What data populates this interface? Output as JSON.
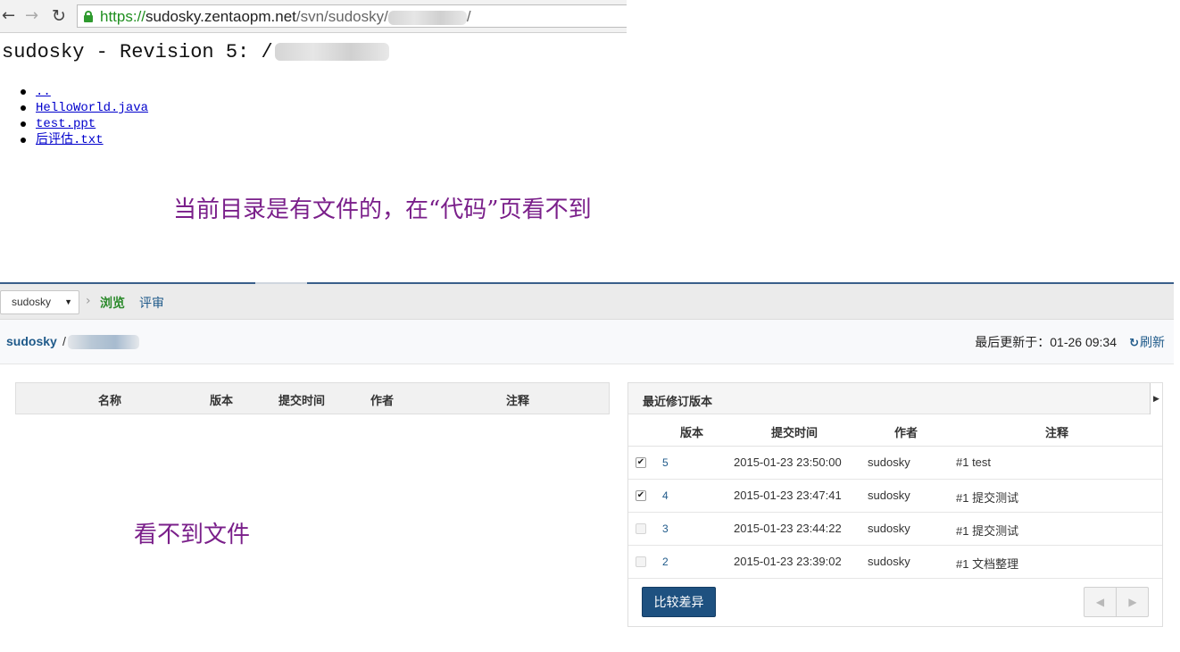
{
  "browser": {
    "url_scheme": "https://",
    "url_host": "sudosky.zentaopm.net",
    "url_path": "/svn/sudosky/",
    "url_tail": "/"
  },
  "svn_listing": {
    "title": "sudosky - Revision 5: /",
    "items": [
      "..",
      "HelloWorld.java",
      "test.ppt",
      "后评估.txt"
    ]
  },
  "annotations": {
    "note_top": "当前目录是有文件的，在“代码”页看不到",
    "note_bottom": "看不到文件"
  },
  "zentao": {
    "repo_select": "sudosky",
    "nav": {
      "browse": "浏览",
      "review": "评审"
    },
    "breadcrumb": {
      "repo": "sudosky",
      "separator": "/"
    },
    "last_update": "最后更新于：01-26 09:34",
    "refresh": "刷新",
    "file_table": {
      "columns": [
        "名称",
        "版本",
        "提交时间",
        "作者",
        "注释"
      ]
    },
    "revisions": {
      "title": "最近修订版本",
      "columns": [
        "版本",
        "提交时间",
        "作者",
        "注释"
      ],
      "rows": [
        {
          "checked": true,
          "revision": "5",
          "time": "2015-01-23 23:50:00",
          "author": "sudosky",
          "comment": "#1 test"
        },
        {
          "checked": true,
          "revision": "4",
          "time": "2015-01-23 23:47:41",
          "author": "sudosky",
          "comment": "#1 提交测试"
        },
        {
          "checked": false,
          "revision": "3",
          "time": "2015-01-23 23:44:22",
          "author": "sudosky",
          "comment": "#1 提交测试"
        },
        {
          "checked": false,
          "revision": "2",
          "time": "2015-01-23 23:39:02",
          "author": "sudosky",
          "comment": "#1 文档整理"
        }
      ],
      "compare_button": "比较差异",
      "pager_prev_icon": "triangle-left-icon",
      "pager_next_icon": "triangle-right-icon"
    }
  },
  "icons": {
    "back": "arrow-left-icon",
    "forward": "arrow-right-icon",
    "reload": "reload-icon",
    "lock": "lock-icon",
    "refresh": "refresh-icon",
    "caret": "caret-down-icon",
    "chevron": "chevron-right-icon",
    "collapse": "caret-right-icon"
  },
  "colors": {
    "annotation": "#7a1f8a",
    "link": "#1f5a8a",
    "browse_active": "#2b8a2b",
    "primary_button": "#1e5180"
  }
}
